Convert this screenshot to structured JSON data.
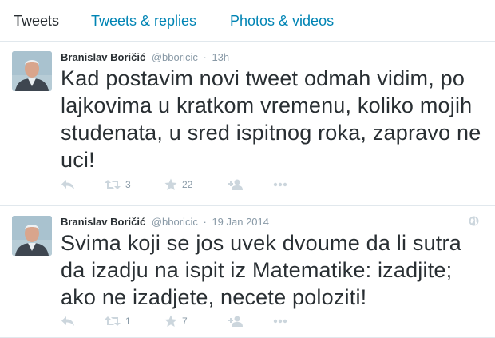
{
  "tabs": [
    {
      "label": "Tweets",
      "active": true
    },
    {
      "label": "Tweets & replies",
      "active": false
    },
    {
      "label": "Photos & videos",
      "active": false
    }
  ],
  "tweets": [
    {
      "fullname": "Branislav Boričić",
      "username": "@bboricic",
      "separator": "·",
      "time": "13h",
      "text": "Kad postavim novi tweet odmah vidim, po lajkovima u kratkom vremenu, koliko mojih studenata, u sred ispitnog roka, zapravo ne uci!",
      "retweets": "3",
      "likes": "22",
      "globe": false
    },
    {
      "fullname": "Branislav Boričić",
      "username": "@bboricic",
      "separator": "·",
      "time": "19 Jan 2014",
      "text": "Svima koji se jos uvek dvoume da li sutra da izadju na ispit iz Matematike: izadjite; ako ne izadjete, necete poloziti!",
      "retweets": "1",
      "likes": "7",
      "globe": true
    }
  ],
  "icons": {
    "reply": "reply-icon",
    "retweet": "retweet-icon",
    "like": "star-icon",
    "follow": "follow-icon",
    "more": "more-icon",
    "globe": "globe-icon"
  },
  "colors": {
    "link": "#0084b4",
    "text": "#292f33",
    "muted": "#8899a6",
    "icon": "#ccd6dd",
    "border": "#e1e8ed"
  }
}
